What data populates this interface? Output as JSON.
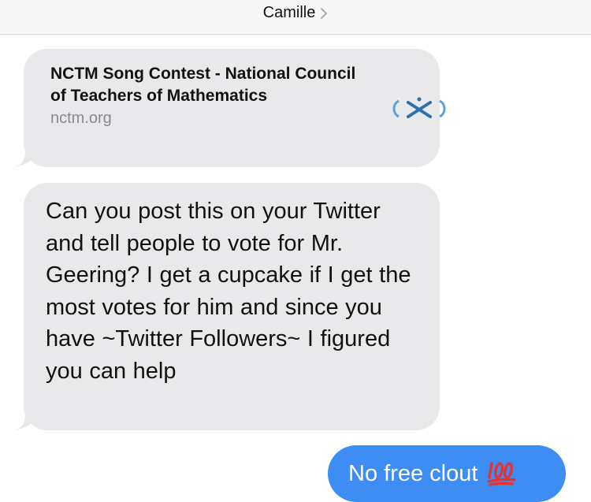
{
  "header": {
    "contact_name": "Camille"
  },
  "messages": {
    "link_preview": {
      "title": "NCTM Song Contest - National Council of Teachers of Mathematics",
      "domain": "nctm.org",
      "logo_icon": "nctm-logo-icon"
    },
    "incoming_text": "Can you post this on your Twitter and tell people to vote for Mr. Geering? I get a cupcake if I get the most votes for him and since you have ~Twitter Followers~ I figured you can help",
    "outgoing_text": "No free clout",
    "outgoing_emoji": "hundred-points-icon"
  },
  "colors": {
    "incoming_bubble": "#e9e9eb",
    "outgoing_bubble": "#3d8df5",
    "header_bg": "#f7f7f7",
    "domain_text": "#8b8b8f",
    "emoji_red": "#e8322c"
  }
}
